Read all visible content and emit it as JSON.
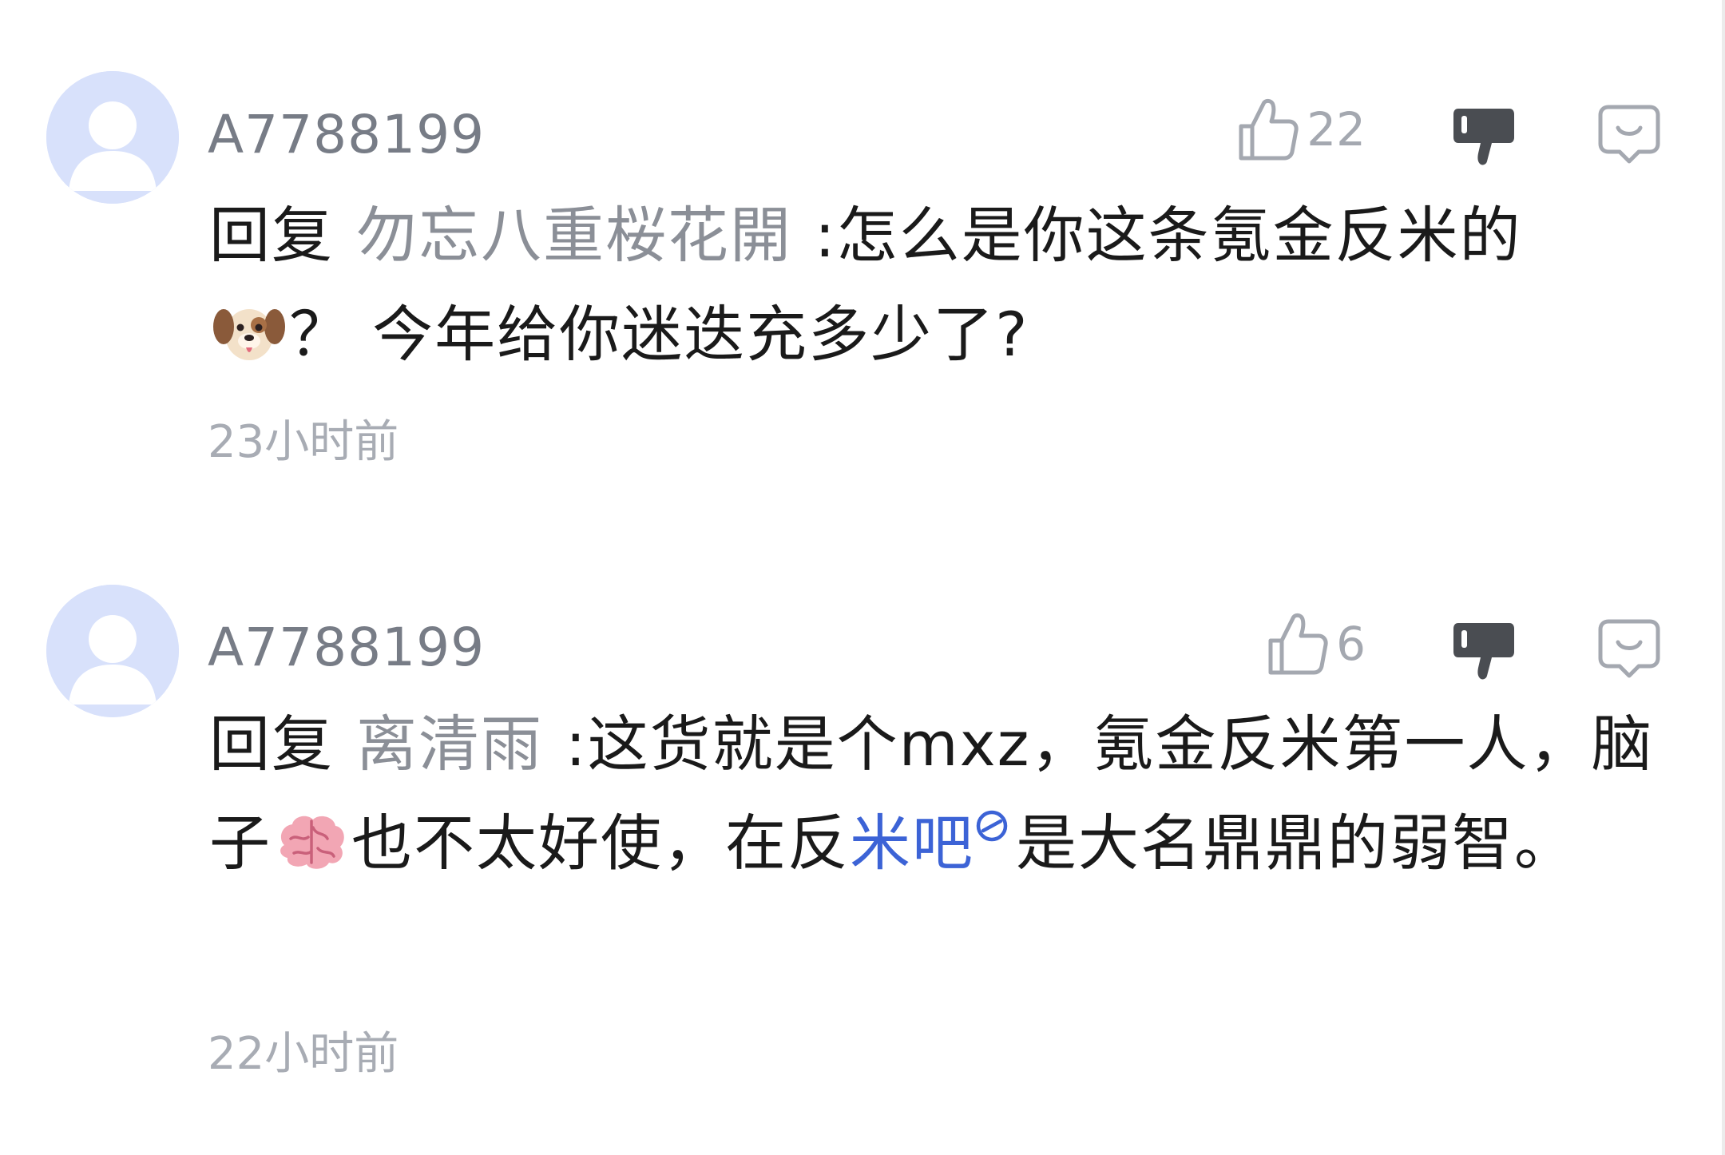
{
  "comments": [
    {
      "username": "A7788199",
      "likes": "22",
      "reply_prefix": "回复",
      "mention": "勿忘八重桜花開",
      "text_part1": ":怎么是你这条氪金反米的",
      "emoji": "dog-face-emoji",
      "text_part2": "？ 今年给你迷迭充多少了?",
      "time": "23小时前"
    },
    {
      "username": "A7788199",
      "likes": "6",
      "reply_prefix": "回复",
      "mention": "离清雨",
      "text_part1": ":这货就是个mxz，氪金反米第一人，脑子",
      "emoji": "brain-emoji",
      "text_part2": "也不太好使，在反",
      "link": "米吧",
      "text_part3": "是大名鼎鼎的弱智。",
      "time": "22小时前"
    }
  ],
  "colors": {
    "username": "#777c86",
    "mention": "#8b8f97",
    "link": "#3c63d6",
    "avatar_bg": "#d8e1fb",
    "muted": "#a8acb4"
  },
  "icons": {
    "like": "thumbs-up-icon",
    "dislike": "thumbs-down-icon",
    "reply": "reply-bubble-icon",
    "link": "link-icon"
  }
}
